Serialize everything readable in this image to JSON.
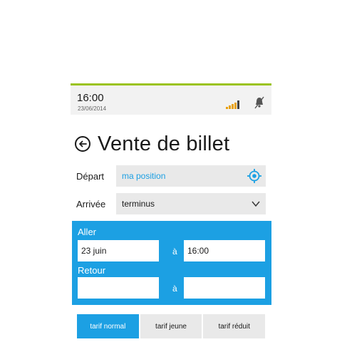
{
  "status": {
    "time": "16:00",
    "date": "23/06/2014"
  },
  "icons": {
    "signal": "signal-bars-icon",
    "mute": "mute-bell-icon",
    "back": "back-arrow-icon",
    "locate": "gps-target-icon",
    "dropdown": "chevron-down-icon"
  },
  "colors": {
    "accent": "#1ca0e3",
    "status_stripe": "#9bc31a",
    "signal": "#e8a10c",
    "field_bg": "#e9e9e9"
  },
  "page": {
    "title": "Vente de billet"
  },
  "form": {
    "depart": {
      "label": "Départ",
      "value": "ma position"
    },
    "arrivee": {
      "label": "Arrivée",
      "value": "terminus"
    }
  },
  "trip": {
    "aller": {
      "label": "Aller",
      "date": "23 juin",
      "sep": "à",
      "time": "16:00"
    },
    "retour": {
      "label": "Retour",
      "date": "",
      "sep": "à",
      "time": ""
    }
  },
  "tabs": [
    {
      "label": "tarif normal",
      "active": true
    },
    {
      "label": "tarif jeune",
      "active": false
    },
    {
      "label": "tarif réduit",
      "active": false
    }
  ]
}
